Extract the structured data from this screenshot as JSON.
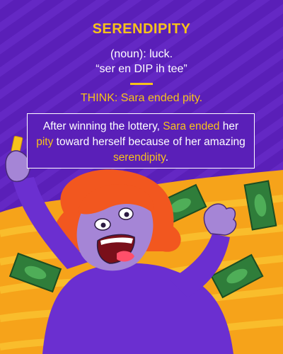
{
  "card": {
    "word": "SERENDIPITY",
    "definition": "(noun): luck.",
    "pronunciation": "“ser en DIP ih tee”",
    "mnemonic_label": "THINK:",
    "mnemonic_text": "Sara ended pity.",
    "sentence": {
      "part1": "After winning the lottery, ",
      "hl1": "Sara ended",
      "part2": " her ",
      "hl2": "pity",
      "part3": " toward herself because of her amazing ",
      "hl3": "serendipity",
      "part4": "."
    }
  },
  "colors": {
    "background": "#5a1fb8",
    "accent": "#f7c21b",
    "text": "#ffffff",
    "ground": "#f6a31a",
    "hair": "#f2571f",
    "skin": "#a585d6",
    "money": "#2f7d3a"
  },
  "illustration": {
    "subject": "woman-celebrating-lottery-win",
    "items": [
      "lottery-ticket",
      "money-bills",
      "red-hair",
      "open-mouth-smile"
    ]
  }
}
